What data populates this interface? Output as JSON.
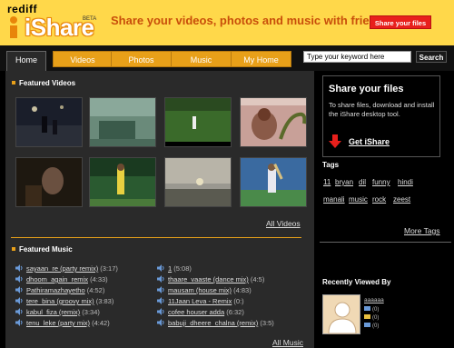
{
  "header": {
    "logo_top": "rediff",
    "logo_main": "iShare",
    "beta": "BETA",
    "tagline": "Share your videos, photos and music with friends",
    "share_button": "Share your files"
  },
  "nav": {
    "tabs": [
      {
        "label": "Home",
        "active": true
      },
      {
        "label": "Videos"
      },
      {
        "label": "Photos"
      },
      {
        "label": "Music"
      },
      {
        "label": "My Home"
      }
    ],
    "search": {
      "value": "Type your keyword here",
      "button": "Search"
    }
  },
  "featured_videos": {
    "title": "Featured Videos",
    "all_link": "All Videos",
    "thumbs": [
      {
        "name": "night-street-video",
        "color": "#1E2230"
      },
      {
        "name": "stadium-crowd-video",
        "color": "#4A7A6A"
      },
      {
        "name": "cricket-field-video",
        "color": "#3A6A2A"
      },
      {
        "name": "child-snake-video",
        "color": "#B8908A"
      },
      {
        "name": "dark-portrait-video",
        "color": "#2A2018"
      },
      {
        "name": "garden-people-video",
        "color": "#2A6A3A"
      },
      {
        "name": "sunset-road-video",
        "color": "#8A8880"
      },
      {
        "name": "cricket-batsman-video",
        "color": "#3A6AA0"
      }
    ]
  },
  "featured_music": {
    "title": "Featured Music",
    "all_link": "All Music",
    "left": [
      {
        "title": "sayaan_re (party remix)",
        "dur": "(3:17)"
      },
      {
        "title": "dhoom_again_remix",
        "dur": "(4:33)"
      },
      {
        "title": "Pathiramazhayetho",
        "dur": "(4:52)"
      },
      {
        "title": "tere_bina (groovy mix)",
        "dur": "(3:83)"
      },
      {
        "title": "kabul_fiza (remix)",
        "dur": "(3:34)"
      },
      {
        "title": "tenu_leke (party mix)",
        "dur": "(4:42)"
      }
    ],
    "right": [
      {
        "title": "1",
        "dur": "(5:08)"
      },
      {
        "title": "thaare_vaaste (dance mix)",
        "dur": "(4:5)"
      },
      {
        "title": "mausam (house mix)",
        "dur": "(4:83)"
      },
      {
        "title": "11Jaan Leva - Remix",
        "dur": "(0:)"
      },
      {
        "title": "cofee houser adda",
        "dur": "(6:32)"
      },
      {
        "title": "babuji_dheere_chalna (remix)",
        "dur": "(3:5)"
      }
    ]
  },
  "share_box": {
    "title": "Share your files",
    "text": "To share files, download and install the iShare desktop tool.",
    "link": "Get iShare"
  },
  "tags": {
    "title": "Tags",
    "row1": [
      "11",
      "bryan",
      "dil",
      "funny",
      "hindi"
    ],
    "row2": [
      "manali",
      "music",
      "rock",
      "zeest"
    ],
    "more": "More Tags"
  },
  "recently_viewed": {
    "title": "Recently Viewed By",
    "user": "aaaaaa",
    "stats": [
      "(0)",
      "(0)",
      "(0)"
    ]
  },
  "colors": {
    "header_bg": "#FFD84A",
    "tab": "#E8A019",
    "accent_red": "#E8201C",
    "panel": "#2A2A2A"
  }
}
